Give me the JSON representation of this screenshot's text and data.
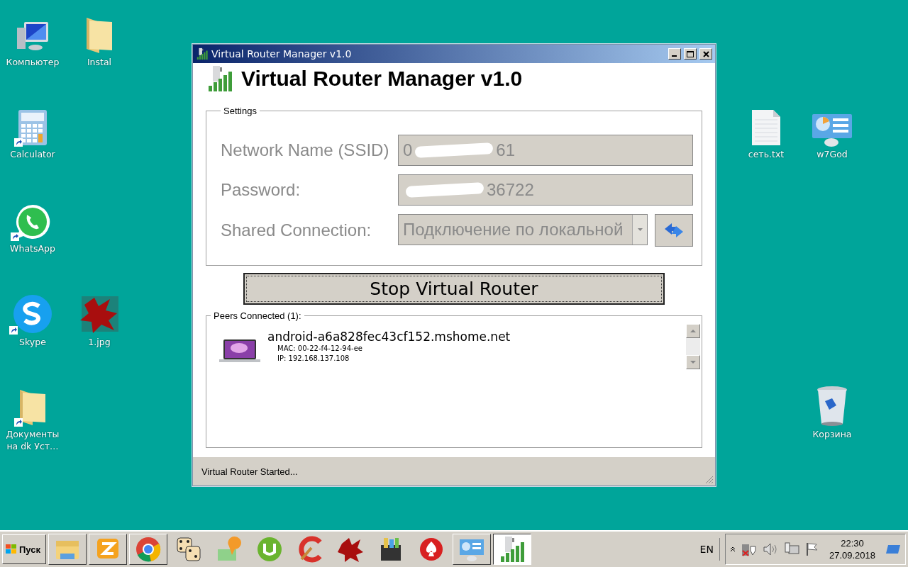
{
  "desktop_icons": [
    {
      "label": "Компьютер",
      "kind": "computer",
      "shortcut": false
    },
    {
      "label": "Instal",
      "kind": "folder",
      "shortcut": false
    },
    {
      "label": "Calculator",
      "kind": "calculator",
      "shortcut": true
    },
    {
      "label": "WhatsApp",
      "kind": "chat",
      "shortcut": true
    },
    {
      "label": "Skype",
      "kind": "skype",
      "shortcut": true
    },
    {
      "label": "1.jpg",
      "kind": "image",
      "shortcut": false
    },
    {
      "label": "Документы на dk Уст…",
      "kind": "folder",
      "shortcut": true
    },
    {
      "label": "сеть.txt",
      "kind": "text",
      "shortcut": false
    },
    {
      "label": "w7God",
      "kind": "panel",
      "shortcut": false
    },
    {
      "label": "Корзина",
      "kind": "bin",
      "shortcut": false
    }
  ],
  "window": {
    "title": "Virtual Router Manager v1.0",
    "heading": "Virtual Router Manager v1.0",
    "settings": {
      "legend": "Settings",
      "disabled": true,
      "fields": [
        {
          "kind": "text",
          "label": "Network Name (SSID)",
          "value_start": "0",
          "value_end": "61",
          "redacted": true
        },
        {
          "kind": "text",
          "label": "Password:",
          "value_end": "36722",
          "redacted": true
        },
        {
          "kind": "combo",
          "label": "Shared Connection:",
          "value_end": "Подключение по локальной",
          "redacted": false
        }
      ]
    },
    "action_button": "Stop Virtual Router",
    "peers": {
      "legend": "Peers Connected (1):",
      "items": [
        {
          "host": "android-a6a828fec43cf152.mshome.net",
          "mac": "MAC: 00-22-f4-12-94-ee",
          "ip": "IP: 192.168.137.108"
        }
      ]
    },
    "status": "Virtual Router Started..."
  },
  "taskbar": {
    "start": "Пуск",
    "apps": [
      {
        "kind": "explorer",
        "open": true,
        "selected": false
      },
      {
        "kind": "zapp",
        "open": true,
        "selected": false
      },
      {
        "kind": "chrome",
        "open": true,
        "selected": false
      },
      {
        "kind": "dice",
        "open": false,
        "selected": false
      },
      {
        "kind": "map",
        "open": false,
        "selected": false
      },
      {
        "kind": "torrent",
        "open": false,
        "selected": false
      },
      {
        "kind": "cleaner",
        "open": false,
        "selected": false
      },
      {
        "kind": "image",
        "open": false,
        "selected": false
      },
      {
        "kind": "archive",
        "open": false,
        "selected": false
      },
      {
        "kind": "poker",
        "open": false,
        "selected": false
      },
      {
        "kind": "panel",
        "open": true,
        "selected": false
      },
      {
        "kind": "router",
        "open": true,
        "selected": true
      }
    ],
    "language": "EN",
    "time": "22:30",
    "date": "27.09.2018"
  }
}
